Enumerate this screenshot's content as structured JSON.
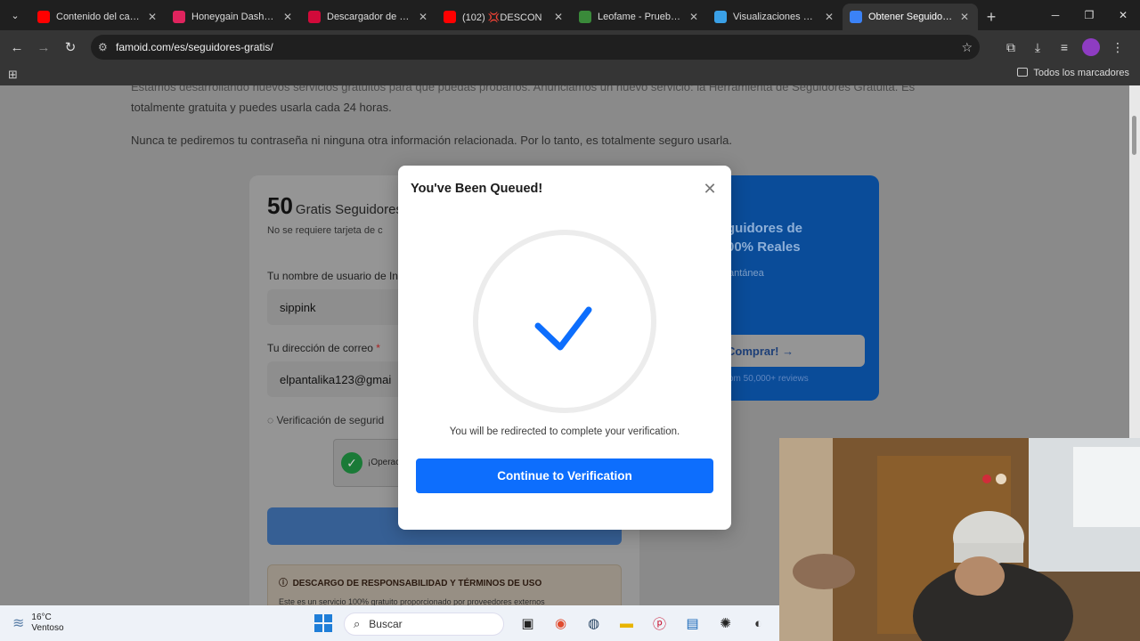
{
  "browser": {
    "tabs": [
      {
        "label": "Contenido del canal",
        "color": "#ff0000"
      },
      {
        "label": "Honeygain Dashboard",
        "color": "#e0245e"
      },
      {
        "label": "Descargador de Vide",
        "color": "#d10a3a"
      },
      {
        "label": "(102) 💢DESCON",
        "color": "#ff0000"
      },
      {
        "label": "Leofame - Prueba gr",
        "color": "#3a8a3a"
      },
      {
        "label": "Visualizaciones Grat",
        "color": "#3aa0e6"
      },
      {
        "label": "Obtener Seguidores",
        "color": "#3b82f6"
      }
    ],
    "url": "famoid.com/es/seguidores-gratis/",
    "bookmarks_label": "Todos los marcadores"
  },
  "page": {
    "intro_line_top": "Estamos desarrollando nuevos servicios gratuitos para que puedas probarlos. Anunciamos un nuevo servicio: la Herramienta de Seguidores Gratuita. Es",
    "intro_line_2": "totalmente gratuita y puedes usarla cada 24 horas.",
    "intro_line_3": "Nunca te pediremos tu contraseña ni ninguna otra información relacionada. Por lo tanto, es totalmente seguro usarla.",
    "count": "50",
    "count_label": "Gratis Seguidores",
    "no_card": "No se requiere tarjeta de c",
    "username_label": "Tu nombre de usuario de In",
    "username_value": "sippink",
    "email_label": "Tu dirección de correo",
    "email_required": "*",
    "email_value": "elpantalika123@gmai",
    "verification_label": "Verificación de segurid",
    "captcha_text": "¡Operac",
    "disclaimer_title": "DESCARGO DE RESPONSABILIDAD Y TÉRMINOS DE USO",
    "disclaimer_text": "Este es un servicio 100% gratuito proporcionado por proveedores externos",
    "promo_title_1": "guidores de",
    "promo_title_2": "00% Reales",
    "promo_instant": "antánea",
    "promo_button": "Comprar! →",
    "promo_reviews": "om 50,000+ reviews"
  },
  "modal": {
    "title": "You've Been Queued!",
    "close_icon": "close-icon",
    "redirect_text": "You will be redirected to complete your verification.",
    "button_label": "Continue to Verification",
    "accent": "#0d6efd"
  },
  "taskbar": {
    "temperature": "16°C",
    "condition": "Ventoso",
    "search_placeholder": "Buscar"
  }
}
